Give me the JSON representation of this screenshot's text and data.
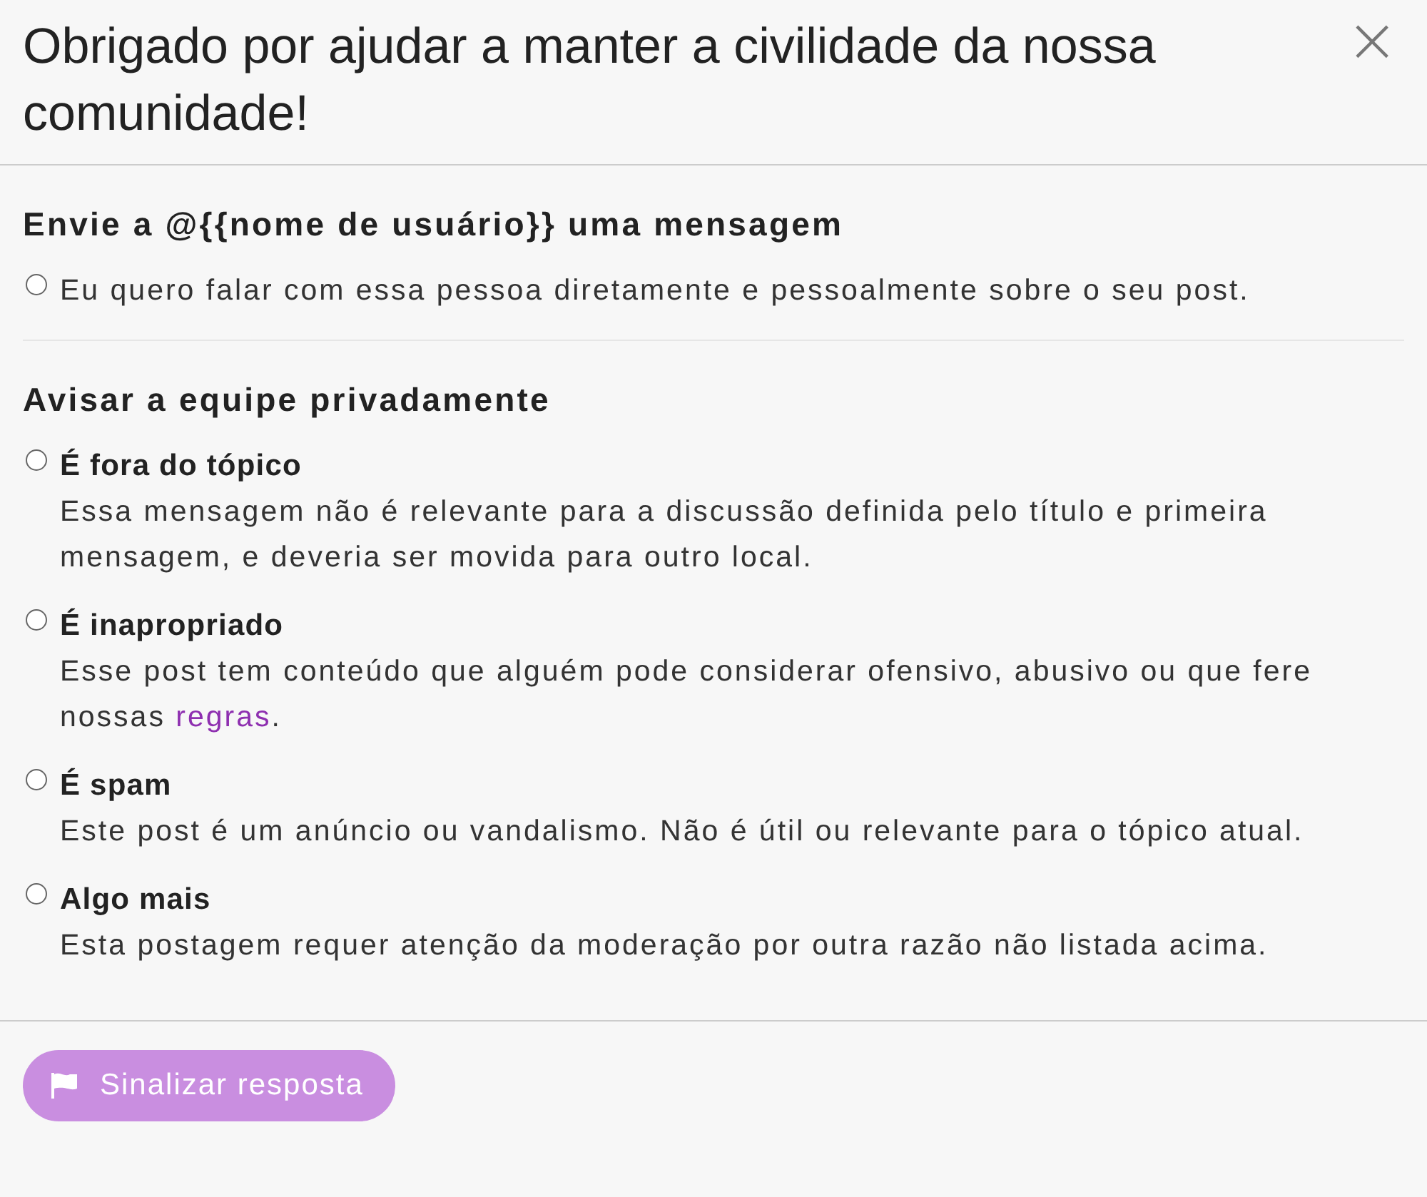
{
  "dialog": {
    "title": "Obrigado por ajudar a manter a civilidade da nossa comunidade!",
    "close": "×"
  },
  "sections": [
    {
      "heading": "Envie a @{{nome de usuário}} uma mensagem",
      "options": [
        {
          "description": "Eu quero falar com essa pessoa diretamente e pessoalmente sobre o seu post.",
          "selected": false
        }
      ]
    },
    {
      "heading": "Avisar a equipe privadamente",
      "options": [
        {
          "label": "É fora do tópico",
          "description": "Essa mensagem não é relevante para a discussão definida pelo título e primeira mensagem, e deveria ser movida para outro local.",
          "selected": false
        },
        {
          "label": "É inapropriado",
          "description": "Esse post tem conteúdo que alguém pode considerar ofensivo, abusivo ou que fere nossas",
          "link": "regras",
          "description_end": ".",
          "selected": false
        },
        {
          "label": "É spam",
          "description": "Este post é um anúncio ou vandalismo. Não é útil ou relevante para o tópico atual.",
          "selected": false
        },
        {
          "label": "Algo mais",
          "description": "Esta postagem requer atenção da moderação por outra razão não listada acima.",
          "selected": false
        }
      ]
    }
  ],
  "submit": {
    "label": "Sinalizar resposta",
    "disabled": true
  }
}
